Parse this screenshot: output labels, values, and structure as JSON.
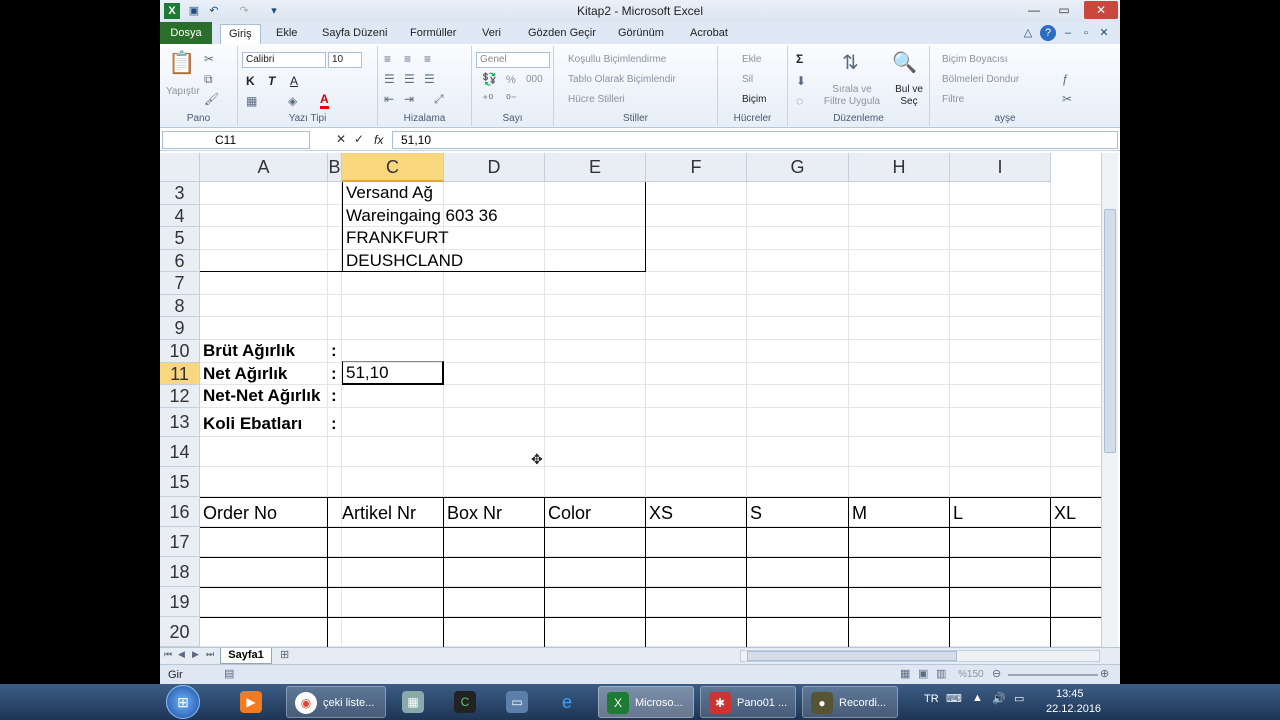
{
  "app": {
    "title": "Kitap2 - Microsoft Excel",
    "qat": {
      "save_icon": "save-icon",
      "undo_icon": "undo-icon",
      "redo_icon": "redo-icon"
    }
  },
  "tabs": [
    "Dosya",
    "Giriş",
    "Ekle",
    "Sayfa Düzeni",
    "Formüller",
    "Veri",
    "Gözden Geçir",
    "Görünüm",
    "Acrobat"
  ],
  "active_tab": "Giriş",
  "ribbon": {
    "pano": {
      "paste": "Yapıştır",
      "label": "Pano"
    },
    "font": {
      "name": "Calibri",
      "size": "10",
      "bold": "K",
      "italic": "T",
      "underline": "A",
      "label": "Yazı Tipi"
    },
    "align": {
      "label": "Hizalama"
    },
    "number": {
      "format": "Genel",
      "percent": "%",
      "comma": "000",
      "label": "Sayı"
    },
    "styles": {
      "cond": "Koşullu Biçimlendirme",
      "table": "Tablo Olarak Biçimlendir",
      "cell": "Hücre Stilleri",
      "label": "Stiller"
    },
    "cells": {
      "insert": "Ekle",
      "delete": "Sil",
      "format": "Biçim",
      "label": "Hücreler"
    },
    "editing": {
      "sum": "Σ",
      "sort": "Sırala ve Filtre Uygula",
      "find": "Bul ve Seç",
      "label": "Düzenleme"
    },
    "ayse": {
      "painter": "Biçim Boyacısı",
      "freeze": "Bölmeleri Dondur",
      "filter": "Filtre",
      "label": "ayşe"
    }
  },
  "formula_bar": {
    "name_box": "C11",
    "fx": "fx",
    "value": "51,10"
  },
  "columns": [
    "A",
    "B",
    "C",
    "D",
    "E",
    "F",
    "G",
    "H",
    "I"
  ],
  "selected_column": "C",
  "rows": [
    "3",
    "4",
    "5",
    "6",
    "7",
    "8",
    "9",
    "10",
    "11",
    "12",
    "13",
    "14",
    "15",
    "16",
    "17",
    "18",
    "19",
    "20"
  ],
  "selected_row": "11",
  "cells": {
    "c3": "Versand Ağ",
    "c4": "Wareingaing 603 36",
    "c5": "FRANKFURT",
    "c6": "DEUSHCLAND",
    "a10": "Brüt Ağırlık",
    "a11": "Net Ağırlık",
    "a12": "Net-Net Ağırlık",
    "a13": "Koli Ebatları",
    "colon": ":",
    "c11": "51,10",
    "headers16": [
      "Order No",
      "Artikel Nr",
      "Box Nr",
      "Color",
      "XS",
      "S",
      "M",
      "L",
      "XL"
    ]
  },
  "sheet": {
    "tab": "Sayfa1"
  },
  "status": {
    "mode": "Gir",
    "zoom": "%150"
  },
  "taskbar": {
    "items": [
      {
        "label": "çeki liste..."
      },
      {
        "label": "Microso..."
      },
      {
        "label": "Pano01 ..."
      },
      {
        "label": "Recordi..."
      }
    ],
    "lang": "TR",
    "time": "13:45",
    "date": "22.12.2016"
  }
}
